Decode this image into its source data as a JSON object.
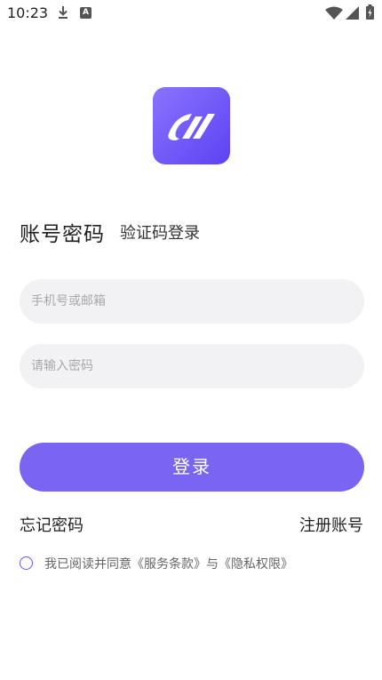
{
  "status_bar": {
    "time": "10:23",
    "icons": [
      "download-icon",
      "a-notification-icon",
      "wifi-icon",
      "signal-icon",
      "battery-icon"
    ],
    "a_icon_glyph": "A"
  },
  "logo": {
    "icon": "app-logo-icon",
    "colors": [
      "#8a73ff",
      "#5c43f2"
    ]
  },
  "tabs": {
    "active_label": "账号密码",
    "inactive_label": "验证码登录"
  },
  "form": {
    "phone_placeholder": "手机号或邮箱",
    "password_placeholder": "请输入密码"
  },
  "login_button_label": "登录",
  "links": {
    "forgot_password": "忘记密码",
    "register": "注册账号"
  },
  "agreement": {
    "text": "我已阅读并同意《服务条款》与《隐私权限》",
    "checked": false
  },
  "colors": {
    "accent": "#7a65f2",
    "input_bg": "#f2f2f4"
  }
}
